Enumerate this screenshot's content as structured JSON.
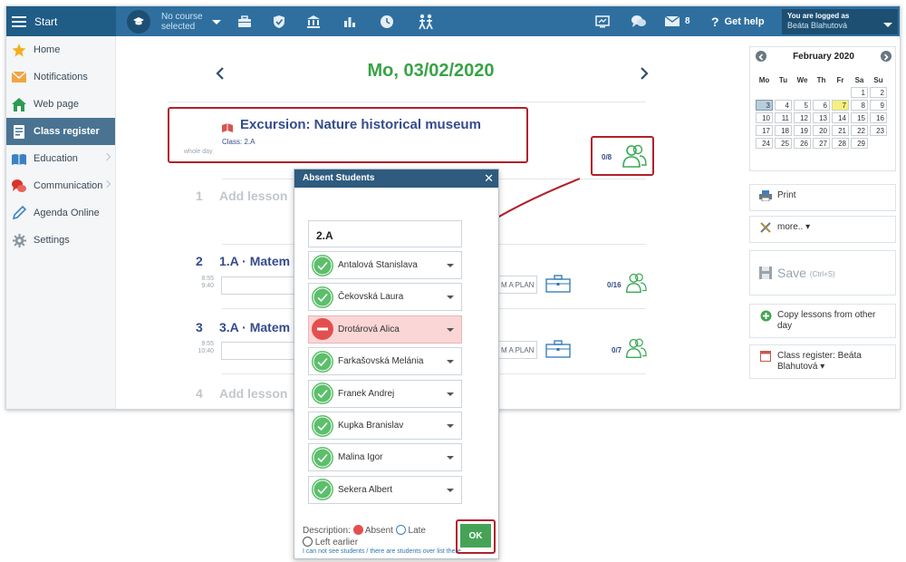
{
  "topbar": {
    "start_label": "Start",
    "course_label": "No course selected",
    "messages_count": "8",
    "help_label": "Get help",
    "user_status": "You are logged as",
    "user_name": "Beáta Blahutová"
  },
  "sidebar": {
    "items": [
      {
        "label": "Home"
      },
      {
        "label": "Notifications"
      },
      {
        "label": "Web page"
      },
      {
        "label": "Class register"
      },
      {
        "label": "Education"
      },
      {
        "label": "Communication"
      },
      {
        "label": "Agenda Online"
      },
      {
        "label": "Settings"
      }
    ]
  },
  "main": {
    "date": "Mo, 03/02/2020",
    "event": {
      "title": "Excursion: Nature historical museum",
      "class_label": "Class: 2.A",
      "duration": "whole day",
      "absent_count": "0/8"
    },
    "lessons": [
      {
        "num": "1",
        "title": "Add lesson"
      },
      {
        "num": "2",
        "title": "1.A · Matem",
        "start": "8:55",
        "end": "9:40",
        "plan_label": "M A PLAN",
        "absent_count": "0/16"
      },
      {
        "num": "3",
        "title": "3.A · Matem",
        "start": "9:55",
        "end": "10:40",
        "plan_label": "M A PLAN",
        "absent_count": "0/7"
      },
      {
        "num": "4",
        "title": "Add lesson"
      }
    ]
  },
  "calendar": {
    "month": "February 2020",
    "weekdays": [
      "Mo",
      "Tu",
      "We",
      "Th",
      "Fr",
      "Sa",
      "Su"
    ],
    "weeks": [
      [
        "",
        "",
        "",
        "",
        "",
        "1",
        "2"
      ],
      [
        "3",
        "4",
        "5",
        "6",
        "7",
        "8",
        "9"
      ],
      [
        "10",
        "11",
        "12",
        "13",
        "14",
        "15",
        "16"
      ],
      [
        "17",
        "18",
        "19",
        "20",
        "21",
        "22",
        "23"
      ],
      [
        "24",
        "25",
        "26",
        "27",
        "28",
        "29",
        ""
      ]
    ],
    "selected_day": "3",
    "today": "7"
  },
  "right_panel": {
    "print_label": "Print",
    "more_label": "more.. ▾",
    "save_label": "Save",
    "save_shortcut": "(Ctrl+S)",
    "copy_label": "Copy lessons from other day",
    "register_label": "Class register: Beáta Blahutová ▾"
  },
  "modal": {
    "title": "Absent Students",
    "class_name": "2.A",
    "students": [
      {
        "name": "Antalová Stanislava",
        "status": "present"
      },
      {
        "name": "Čekovská Laura",
        "status": "present"
      },
      {
        "name": "Drotárová Alica",
        "status": "absent"
      },
      {
        "name": "Farkašovská Melánia",
        "status": "present"
      },
      {
        "name": "Franek Andrej",
        "status": "present"
      },
      {
        "name": "Kupka Branislav",
        "status": "present"
      },
      {
        "name": "Malina Igor",
        "status": "present"
      },
      {
        "name": "Sekera Albert",
        "status": "present"
      }
    ],
    "desc_label": "Description:",
    "absent_label": "Absent",
    "late_label": "Late",
    "left_label": "Left earlier",
    "help_text": "I can not see students / there are students over list there",
    "ok_label": "OK"
  },
  "colors": {
    "topbar": "#2f6f9f",
    "date_green": "#38a346",
    "highlight_red": "#b0212b",
    "present_green": "#4fb35d",
    "absent_red": "#e34f4f",
    "today_yellow": "#f6f07a"
  },
  "icons": [
    "menu-icon",
    "graduation-cap-icon",
    "briefcase-icon",
    "shield-icon",
    "bank-icon",
    "bar-chart-icon",
    "clock-icon",
    "people-icon",
    "screen-icon",
    "chat-icon",
    "mail-icon",
    "help-icon"
  ]
}
